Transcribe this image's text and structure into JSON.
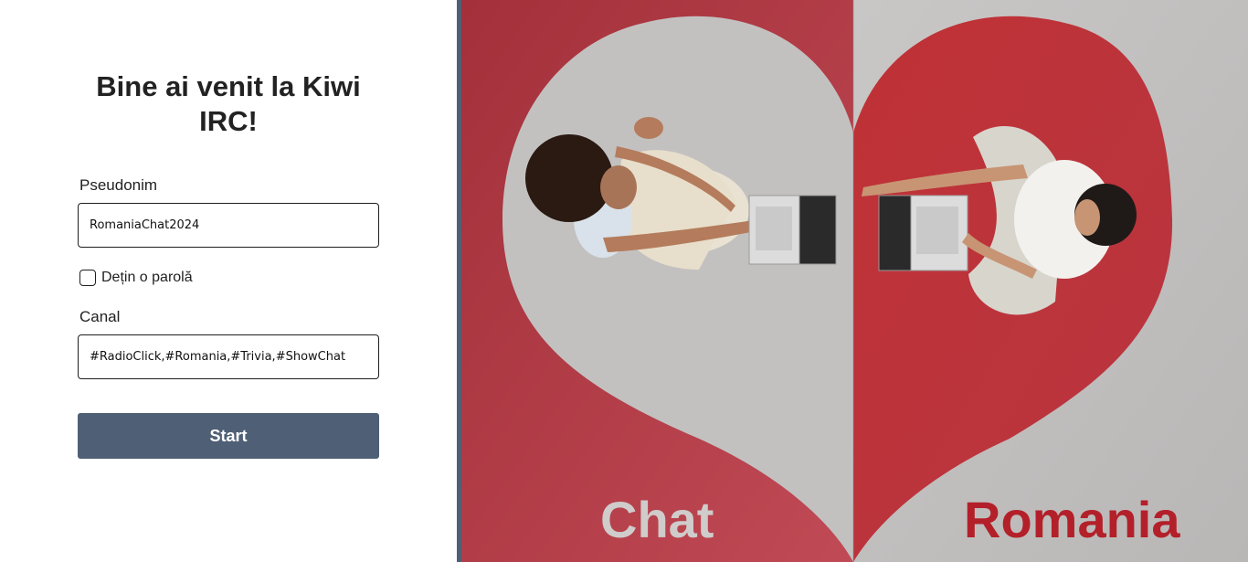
{
  "login": {
    "title": "Bine ai venit la Kiwi IRC!",
    "nick_label": "Pseudonim",
    "nick_value": "RomaniaChat2024",
    "password_label": "Dețin o parolă",
    "password_checked": false,
    "channel_label": "Canal",
    "channel_value": "#RadioClick,#Romania,#Trivia,#ShowChat",
    "start_label": "Start"
  },
  "hero": {
    "left_word": "Chat",
    "right_word": "Romania"
  },
  "colors": {
    "button": "#4f5f75",
    "floor_red": "#b8343a",
    "floor_gray": "#c3c1c0",
    "title_text": "#222222"
  }
}
